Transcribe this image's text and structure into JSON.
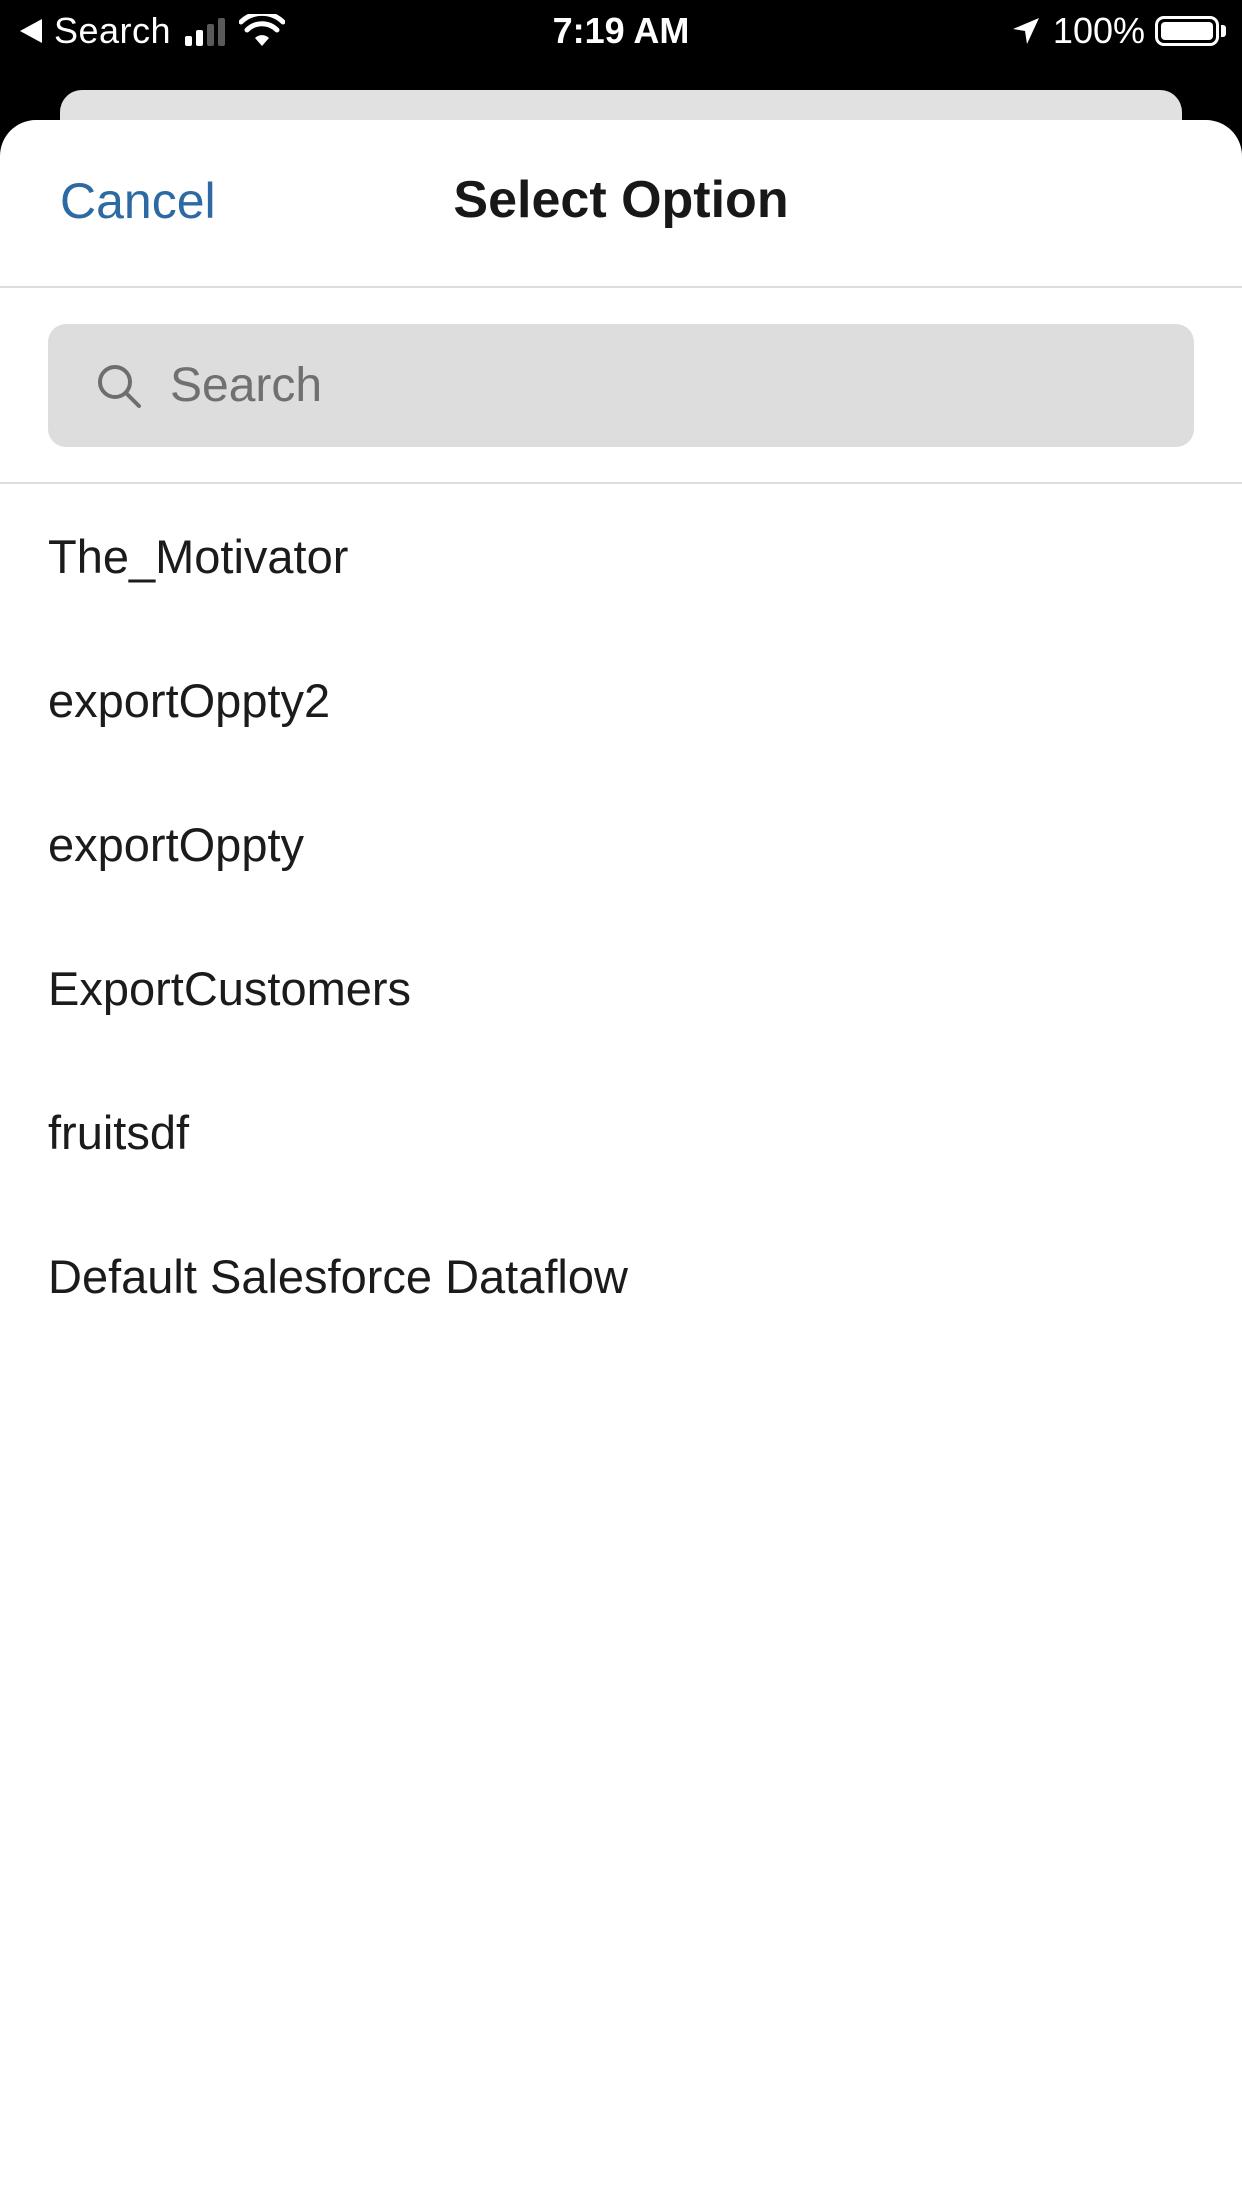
{
  "status_bar": {
    "back_label": "Search",
    "time": "7:19 AM",
    "battery": "100%"
  },
  "header": {
    "cancel_label": "Cancel",
    "title": "Select Option"
  },
  "search": {
    "placeholder": "Search",
    "value": ""
  },
  "options": [
    {
      "label": "The_Motivator"
    },
    {
      "label": "exportOppty2"
    },
    {
      "label": "exportOppty"
    },
    {
      "label": "ExportCustomers"
    },
    {
      "label": "fruitsdf"
    },
    {
      "label": "Default Salesforce Dataflow"
    }
  ],
  "colors": {
    "accent": "#2d6aa3",
    "search_bg": "#dddddd",
    "divider": "#dddddd"
  }
}
